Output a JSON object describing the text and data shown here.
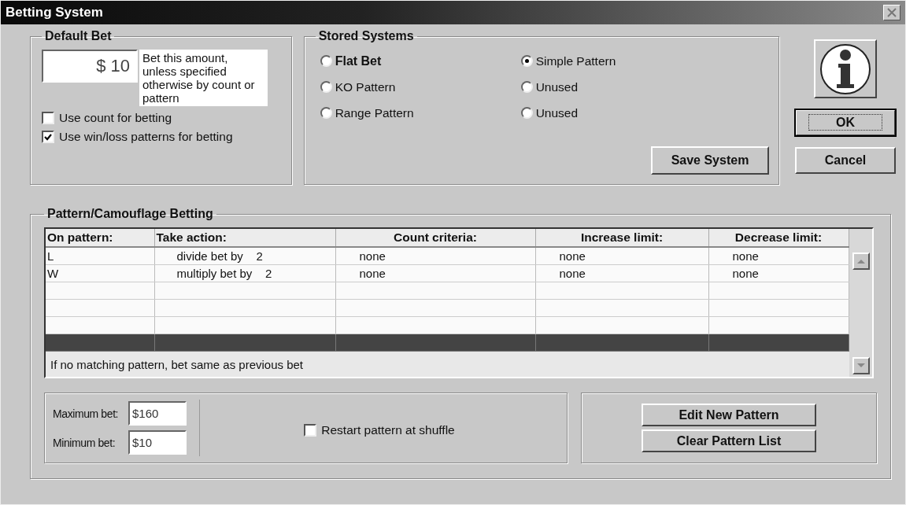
{
  "window": {
    "title": "Betting System"
  },
  "default_bet": {
    "title": "Default Bet",
    "amount": "$ 10",
    "note": "Bet this amount, unless specified otherwise by count or pattern",
    "checkboxes": [
      {
        "label": "Use count for betting",
        "checked": false
      },
      {
        "label": "Use win/loss patterns for betting",
        "checked": true
      }
    ]
  },
  "stored_systems": {
    "title": "Stored Systems",
    "options": [
      {
        "label": "Flat Bet",
        "selected": false,
        "bold": true
      },
      {
        "label": "KO Pattern",
        "selected": false,
        "bold": false
      },
      {
        "label": "Range Pattern",
        "selected": false,
        "bold": false
      },
      {
        "label": "Simple Pattern",
        "selected": true,
        "bold": false
      },
      {
        "label": "Unused",
        "selected": false,
        "bold": false
      },
      {
        "label": "Unused",
        "selected": false,
        "bold": false
      }
    ],
    "save_button": "Save System"
  },
  "dialog_buttons": [
    {
      "label": "OK",
      "default": true
    },
    {
      "label": "Cancel",
      "default": false
    }
  ],
  "pattern_betting": {
    "title": "Pattern/Camouflage Betting",
    "table": {
      "columns": [
        "On pattern:",
        "Take action:",
        "Count criteria:",
        "Increase limit:",
        "Decrease limit:"
      ],
      "rows": [
        {
          "selected": false,
          "cells": [
            "L",
            "divide bet by    2",
            "none",
            "none",
            "none"
          ]
        },
        {
          "selected": false,
          "cells": [
            "W",
            "multiply bet by    2",
            "none",
            "none",
            "none"
          ]
        },
        {
          "selected": false
        },
        {
          "selected": false
        },
        {
          "selected": false
        },
        {
          "selected": true
        }
      ],
      "footer": "If no matching pattern, bet same as previous bet"
    },
    "maximum_bet": {
      "label": "Maximum bet:",
      "value": "$160"
    },
    "minimum_bet": {
      "label": "Minimum bet:",
      "value": "$10"
    },
    "restart_checkbox": {
      "label": "Restart pattern at shuffle",
      "checked": false
    },
    "buttons": [
      "Edit New Pattern",
      "Clear Pattern List"
    ]
  }
}
